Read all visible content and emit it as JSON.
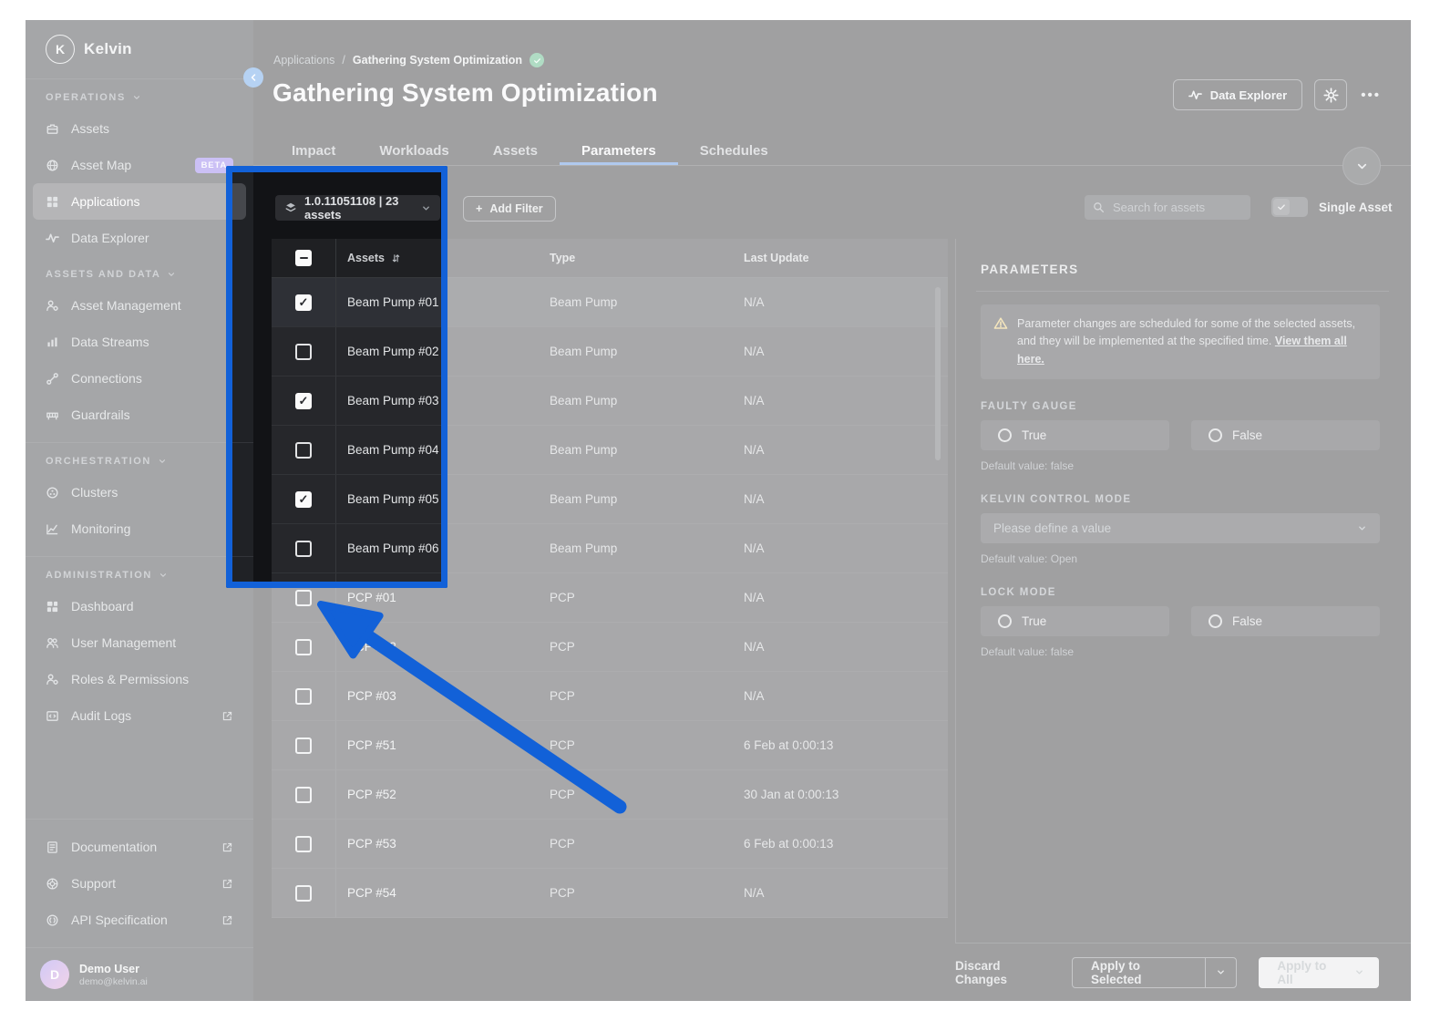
{
  "app": {
    "brand": "Kelvin",
    "logo_letter": "K"
  },
  "sidebar": {
    "sections": [
      {
        "label": "OPERATIONS",
        "items": [
          {
            "label": "Assets"
          },
          {
            "label": "Asset Map",
            "badge": "BETA"
          },
          {
            "label": "Applications",
            "active": true
          },
          {
            "label": "Data Explorer"
          }
        ]
      },
      {
        "label": "ASSETS AND DATA",
        "items": [
          {
            "label": "Asset Management"
          },
          {
            "label": "Data Streams"
          },
          {
            "label": "Connections"
          },
          {
            "label": "Guardrails"
          }
        ]
      },
      {
        "label": "ORCHESTRATION",
        "items": [
          {
            "label": "Clusters"
          },
          {
            "label": "Monitoring"
          }
        ]
      },
      {
        "label": "ADMINISTRATION",
        "items": [
          {
            "label": "Dashboard"
          },
          {
            "label": "User Management"
          },
          {
            "label": "Roles & Permissions"
          },
          {
            "label": "Audit Logs",
            "external": true
          }
        ]
      }
    ],
    "footer_items": [
      {
        "label": "Documentation",
        "external": true
      },
      {
        "label": "Support",
        "external": true
      },
      {
        "label": "API Specification",
        "external": true
      }
    ],
    "user": {
      "initial": "D",
      "name": "Demo User",
      "email": "demo@kelvin.ai"
    }
  },
  "breadcrumb": {
    "parent": "Applications",
    "separator": "/",
    "current": "Gathering System Optimization"
  },
  "header": {
    "title": "Gathering System Optimization",
    "data_explorer_label": "Data Explorer",
    "more_label": "•••"
  },
  "tabs": [
    {
      "label": "Impact"
    },
    {
      "label": "Workloads"
    },
    {
      "label": "Assets"
    },
    {
      "label": "Parameters",
      "active": true
    },
    {
      "label": "Schedules"
    }
  ],
  "toolbar": {
    "version_label": "1.0.11051108 | 23 assets",
    "add_filter_plus": "+",
    "add_filter_label": "Add Filter",
    "search_placeholder": "Search for assets",
    "single_asset_label": "Single Asset"
  },
  "table": {
    "columns": {
      "assets": "Assets",
      "type": "Type",
      "last_update": "Last Update"
    },
    "header_checkbox_state": "indeterminate",
    "rows": [
      {
        "name": "Beam Pump #01",
        "type": "Beam Pump",
        "last_update": "N/A",
        "checked": true
      },
      {
        "name": "Beam Pump #02",
        "type": "Beam Pump",
        "last_update": "N/A",
        "checked": false
      },
      {
        "name": "Beam Pump #03",
        "type": "Beam Pump",
        "last_update": "N/A",
        "checked": true
      },
      {
        "name": "Beam Pump #04",
        "type": "Beam Pump",
        "last_update": "N/A",
        "checked": false
      },
      {
        "name": "Beam Pump #05",
        "type": "Beam Pump",
        "last_update": "N/A",
        "checked": true
      },
      {
        "name": "Beam Pump #06",
        "type": "Beam Pump",
        "last_update": "N/A",
        "checked": false
      },
      {
        "name": "PCP #01",
        "type": "PCP",
        "last_update": "N/A",
        "checked": false
      },
      {
        "name": "PCP #02",
        "type": "PCP",
        "last_update": "N/A",
        "checked": false
      },
      {
        "name": "PCP #03",
        "type": "PCP",
        "last_update": "N/A",
        "checked": false
      },
      {
        "name": "PCP #51",
        "type": "PCP",
        "last_update": "6 Feb at 0:00:13",
        "checked": false
      },
      {
        "name": "PCP #52",
        "type": "PCP",
        "last_update": "30 Jan at 0:00:13",
        "checked": false
      },
      {
        "name": "PCP #53",
        "type": "PCP",
        "last_update": "6 Feb at 0:00:13",
        "checked": false
      },
      {
        "name": "PCP #54",
        "type": "PCP",
        "last_update": "N/A",
        "checked": false
      }
    ]
  },
  "parameters": {
    "heading": "PARAMETERS",
    "warning_line1": "Parameter changes are scheduled for some of the selected assets, and they will",
    "warning_line2": "be implemented at the specified time.",
    "warning_link": "View them all here.",
    "fields": [
      {
        "label": "FAULTY GAUGE",
        "type": "radio",
        "options": [
          "True",
          "False"
        ],
        "default_note": "Default value: false"
      },
      {
        "label": "KELVIN CONTROL MODE",
        "type": "select",
        "placeholder": "Please define a value",
        "default_note": "Default value: Open"
      },
      {
        "label": "LOCK MODE",
        "type": "radio",
        "options": [
          "True",
          "False"
        ],
        "default_note": "Default value: false"
      }
    ]
  },
  "footer": {
    "discard_label": "Discard Changes",
    "apply_selected_label": "Apply to Selected",
    "apply_all_label": "Apply to All"
  },
  "colors": {
    "highlight_blue": "#1261d8",
    "accent_blue": "#3b78d4",
    "beta_purple": "#7e63e6",
    "success_green": "#3aa76d",
    "warning_yellow": "#e5c05b"
  }
}
